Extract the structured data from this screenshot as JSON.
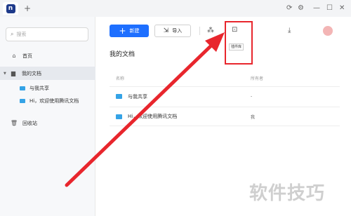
{
  "titlebar": {
    "new_tab": "+",
    "logo": "n",
    "icons": [
      "refresh-icon",
      "settings-icon",
      "minimize-icon",
      "maximize-icon",
      "close-icon"
    ]
  },
  "sidebar": {
    "search_placeholder": "搜索",
    "items": [
      {
        "label": "首页",
        "icon": "home-icon"
      },
      {
        "label": "我的文档",
        "icon": "document-icon",
        "expanded": true
      },
      {
        "label": "与我共享",
        "icon": "folder-icon"
      },
      {
        "label": "Hi，欢迎使用腾讯文档",
        "icon": "folder-icon"
      },
      {
        "label": "回收站",
        "icon": "trash-icon"
      }
    ]
  },
  "toolbar": {
    "new_label": "新建",
    "import_label": "导入",
    "tooltip": "插件库"
  },
  "main": {
    "heading": "我的文档",
    "columns": {
      "name": "名称",
      "owner": "所有者"
    },
    "rows": [
      {
        "name": "与我共享",
        "owner": "-"
      },
      {
        "name": "Hi，欢迎使用腾讯文档",
        "owner": "我"
      }
    ]
  },
  "annotation": {
    "color": "#e8262d"
  },
  "watermark": "软件技巧",
  "colors": {
    "accent": "#1e6fff",
    "folder": "#35a3e6"
  }
}
